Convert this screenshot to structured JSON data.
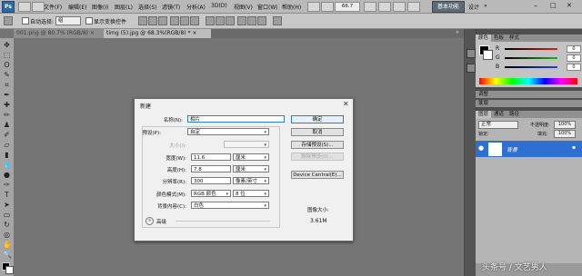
{
  "app": {
    "logo": "Ps",
    "menu": [
      "文件(F)",
      "编辑(E)",
      "图像(I)",
      "图层(L)",
      "选择(S)",
      "滤镜(T)",
      "分析(A)",
      "3D(D)",
      "视图(V)",
      "窗口(W)",
      "帮助(H)"
    ],
    "zoom": "66.7",
    "workspace_button": "基本功能",
    "workspace_link": "设计",
    "more": "»"
  },
  "options": {
    "auto_select": "自动选择:",
    "auto_select_value": "组",
    "show_transform": "显示变换控件"
  },
  "tabs": [
    {
      "label": "001.png @ 80.7% (RGB/8) ×"
    },
    {
      "label": "timg (5).jpg @ 68.3%(RGB/8) * ×"
    }
  ],
  "panels": {
    "color_tabs": [
      "颜色",
      "色板",
      "样式"
    ],
    "color_channels": [
      {
        "name": "R",
        "value": "0",
        "color": "#e02020"
      },
      {
        "name": "G",
        "value": "0",
        "color": "#20b020"
      },
      {
        "name": "B",
        "value": "0",
        "color": "#2040e0"
      }
    ],
    "adjust_tab": "调整",
    "masks_tab": "蒙版",
    "layers_tabs": [
      "图层",
      "通道",
      "路径"
    ],
    "blend_mode": "正常",
    "opacity_label": "不透明度:",
    "opacity": "100%",
    "lock_label": "锁定:",
    "fill_label": "填充:",
    "fill": "100%",
    "layer_name": "背景"
  },
  "dialog": {
    "title": "新建",
    "close": "✕",
    "name_label": "名称(N):",
    "name_value": "相片",
    "preset_label": "预设(P):",
    "preset_value": "自定",
    "size_label": "大小(I):",
    "width_label": "宽度(W):",
    "width_value": "11.6",
    "width_unit": "厘米",
    "height_label": "高度(H):",
    "height_value": "7.8",
    "height_unit": "厘米",
    "resolution_label": "分辨率(R):",
    "resolution_value": "300",
    "resolution_unit": "像素/英寸",
    "mode_label": "颜色模式(M):",
    "mode_value": "RGB 颜色",
    "bit_value": "8 位",
    "bg_label": "背景内容(C):",
    "bg_value": "白色",
    "advanced": "高级",
    "ok": "确定",
    "cancel": "取消",
    "save_preset": "存储预设(S)...",
    "delete_preset": "删除预设(D)...",
    "device_central": "Device Central(E)...",
    "image_size_label": "图像大小:",
    "image_size_value": "3.61M"
  },
  "watermark": "头条号 / 文艺男人"
}
